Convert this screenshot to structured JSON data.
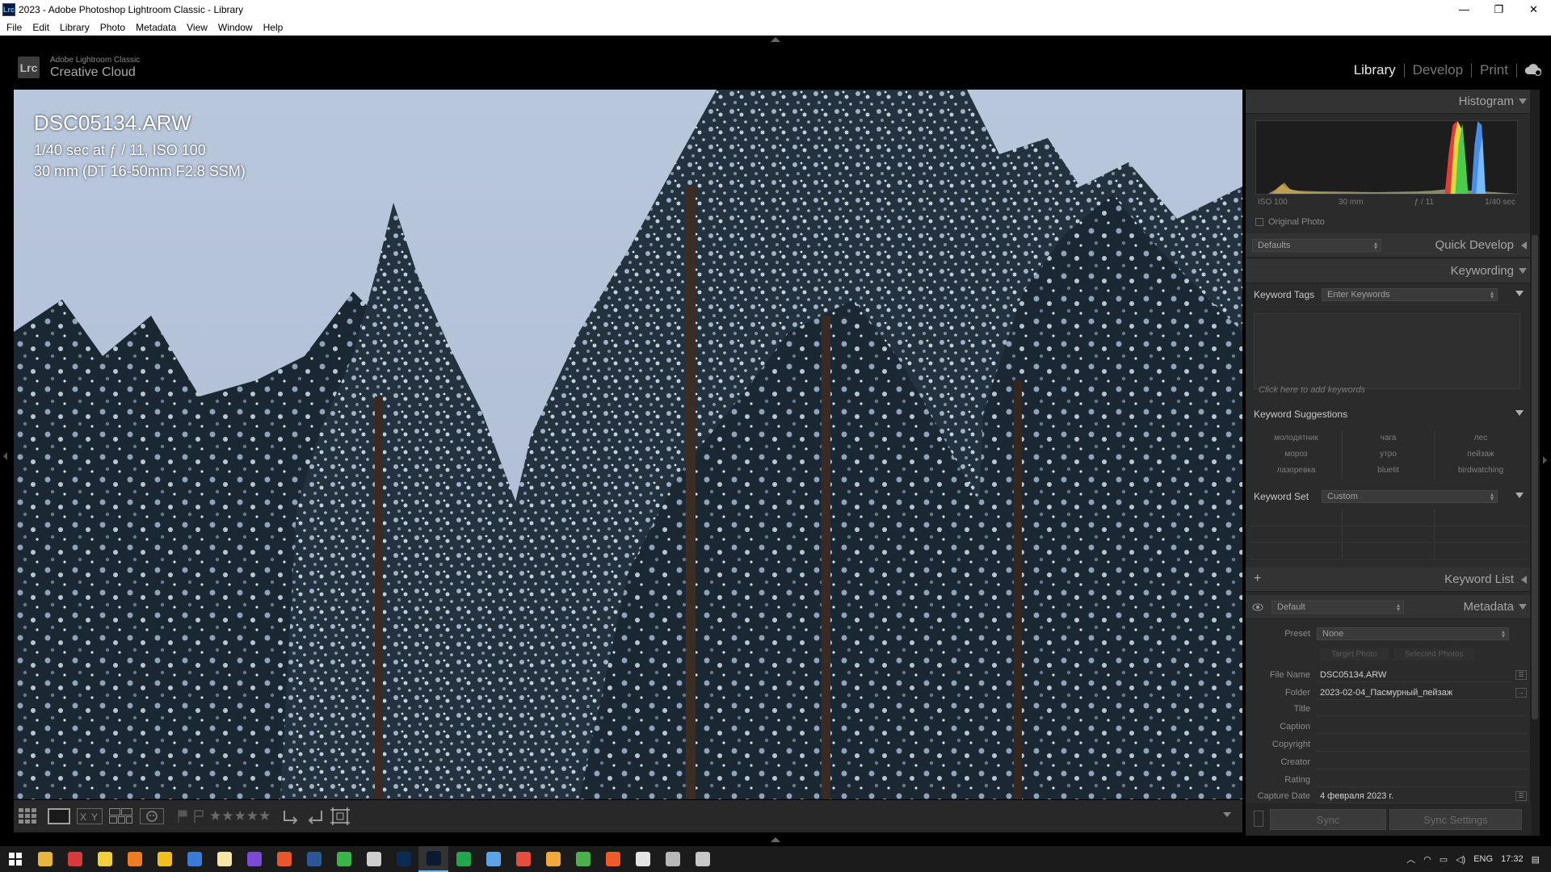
{
  "window": {
    "title": "2023 - Adobe Photoshop Lightroom Classic - Library",
    "app_icon": "Lrc",
    "min_glyph": "—",
    "max_glyph": "❐",
    "close_glyph": "✕"
  },
  "menu": [
    "File",
    "Edit",
    "Library",
    "Photo",
    "Metadata",
    "View",
    "Window",
    "Help"
  ],
  "identity": {
    "logo": "Lrc",
    "line1": "Adobe Lightroom Classic",
    "line2": "Creative Cloud"
  },
  "modules": {
    "items": [
      "Library",
      "Develop",
      "Print"
    ],
    "active": "Library"
  },
  "photo_info": {
    "file_name": "DSC05134.ARW",
    "exposure": "1/40 sec at ƒ / 11, ISO 100",
    "lens": "30 mm (DT 16-50mm F2.8 SSM)"
  },
  "toolbar": {
    "stars": "★★★★★"
  },
  "histogram": {
    "header": "Histogram",
    "iso": "ISO 100",
    "focal": "30 mm",
    "aperture": "ƒ / 11",
    "shutter": "1/40 sec",
    "original_photo": "Original Photo"
  },
  "quick_develop": {
    "header": "Quick Develop",
    "preset": "Defaults"
  },
  "keywording": {
    "header": "Keywording",
    "tags_label": "Keyword Tags",
    "tags_value": "Enter Keywords",
    "hint": "Click here to add keywords",
    "suggestions_label": "Keyword Suggestions",
    "suggestions": [
      "молодятник",
      "чага",
      "лес",
      "мороз",
      "утро",
      "пейзаж",
      "лазоревка",
      "bluetit",
      "birdwatching"
    ],
    "set_label": "Keyword Set",
    "set_value": "Custom"
  },
  "keyword_list": {
    "header": "Keyword List",
    "add": "+"
  },
  "metadata": {
    "header": "Metadata",
    "view": "Default",
    "preset_label": "Preset",
    "preset_value": "None",
    "target_tab": "Target Photo",
    "selected_tab": "Selected Photos",
    "fields": [
      {
        "label": "File Name",
        "value": "DSC05134.ARW"
      },
      {
        "label": "Folder",
        "value": "2023-02-04_Пасмурный_пейзаж"
      },
      {
        "label": "Title",
        "value": ""
      },
      {
        "label": "Caption",
        "value": ""
      },
      {
        "label": "Copyright",
        "value": ""
      },
      {
        "label": "Creator",
        "value": ""
      },
      {
        "label": "Rating",
        "value": ""
      },
      {
        "label": "Capture Date",
        "value": "4 февраля 2023 г."
      }
    ]
  },
  "sync": {
    "sync": "Sync",
    "sync_settings": "Sync Settings"
  },
  "taskbar": {
    "lang": "ENG",
    "time": "17:32",
    "apps": [
      {
        "name": "explorer",
        "color": "#e8b63c"
      },
      {
        "name": "vivaldi",
        "color": "#d63a3a"
      },
      {
        "name": "notes",
        "color": "#f2d03b"
      },
      {
        "name": "app-orange",
        "color": "#f07c22"
      },
      {
        "name": "app-yellow",
        "color": "#f0c020"
      },
      {
        "name": "app-blue",
        "color": "#3a7bd5"
      },
      {
        "name": "app-note",
        "color": "#f5e6a8"
      },
      {
        "name": "app-purple",
        "color": "#7b4bd8"
      },
      {
        "name": "app-fire",
        "color": "#e8562a"
      },
      {
        "name": "word",
        "color": "#2b5797"
      },
      {
        "name": "refresh",
        "color": "#3ab54a"
      },
      {
        "name": "app-gray",
        "color": "#cfcfcf"
      },
      {
        "name": "photoshop",
        "color": "#0b2b54"
      },
      {
        "name": "lightroom",
        "color": "#0a1a33"
      },
      {
        "name": "app-green",
        "color": "#22a84a"
      },
      {
        "name": "app-camera",
        "color": "#5ba4e6"
      },
      {
        "name": "chrome",
        "color": "#e84d3c"
      },
      {
        "name": "app-palette",
        "color": "#f2a93b"
      },
      {
        "name": "app-map",
        "color": "#4cae4c"
      },
      {
        "name": "brave",
        "color": "#f05a28"
      },
      {
        "name": "settings",
        "color": "#e5e5e5"
      },
      {
        "name": "app-cat",
        "color": "#b8b8b8"
      },
      {
        "name": "app-cat2",
        "color": "#c8c8c8"
      }
    ]
  }
}
